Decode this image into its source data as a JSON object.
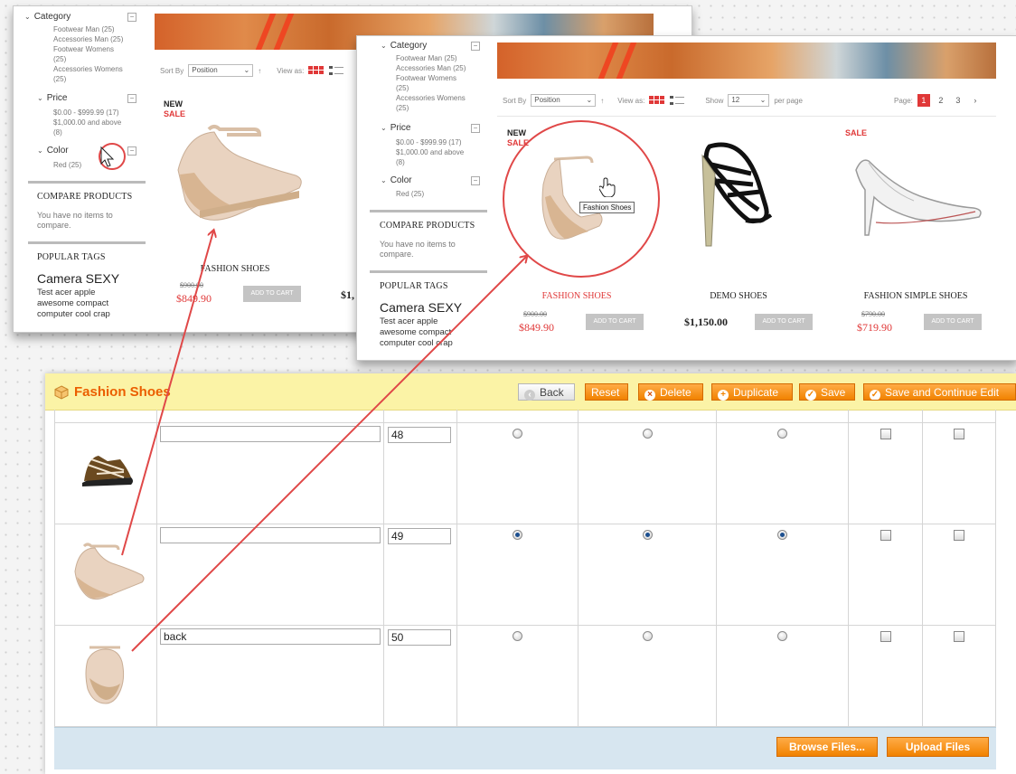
{
  "store": {
    "filters": {
      "category": {
        "title": "Category",
        "items": [
          "Footwear Man (25)",
          "Accessories Man (25)",
          "Footwear Womens",
          "(25)",
          "Accessories Womens",
          "(25)"
        ]
      },
      "price": {
        "title": "Price",
        "items": [
          "$0.00 - $999.99 (17)",
          "$1,000.00 and above",
          "(8)"
        ]
      },
      "color": {
        "title": "Color",
        "items": [
          "Red (25)"
        ]
      }
    },
    "compare": {
      "title": "COMPARE PRODUCTS",
      "text_1": "You have no items to",
      "text_2": "compare."
    },
    "tags": {
      "title": "POPULAR TAGS",
      "big": "Camera SEXY",
      "line1": "Test  acer  apple",
      "line2": "awesome  compact",
      "line3": "computer  cool  crap"
    },
    "toolbar": {
      "sort_label": "Sort By",
      "sort_value": "Position",
      "sort_arrow": "↑",
      "view_label": "View as:",
      "show_label": "Show",
      "show_value": "12",
      "per_page": "per page",
      "page_label": "Page:",
      "pages": [
        "1",
        "2",
        "3"
      ],
      "next": "›"
    },
    "products": [
      {
        "new": "NEW",
        "sale": "SALE",
        "name": "FASHION SHOES",
        "old_price": "$900.00",
        "price": "$849.90",
        "button": "ADD TO CART",
        "tooltip": "Fashion Shoes"
      },
      {
        "name": "DEMO SHOES",
        "price": "$1,150.00",
        "button": "ADD TO CART"
      },
      {
        "sale": "SALE",
        "name": "FASHION SIMPLE SHOES",
        "old_price": "$790.00",
        "price": "$719.90",
        "button": "ADD TO CART"
      }
    ],
    "back_shot": {
      "new": "NEW",
      "sale": "SALE",
      "name": "FASHION SHOES",
      "old_price": "$900.00",
      "price": "$849.90",
      "button": "ADD TO CART",
      "partial_price": "$1,"
    }
  },
  "admin": {
    "title": "Fashion Shoes",
    "buttons": {
      "back": "Back",
      "reset": "Reset",
      "delete": "Delete",
      "duplicate": "Duplicate",
      "save": "Save",
      "save_continue": "Save and Continue Edit"
    },
    "rows": [
      {
        "label": "",
        "position": "48",
        "base": false,
        "small": false,
        "thumb": false
      },
      {
        "label": "",
        "position": "49",
        "base": true,
        "small": true,
        "thumb": true
      },
      {
        "label": "back",
        "position": "50",
        "base": false,
        "small": false,
        "thumb": false
      }
    ],
    "browse_button": "Browse Files...",
    "upload_button": "Upload Files"
  },
  "colors": {
    "accent_orange": "#f18200",
    "title_orange": "#eb5e00",
    "sale_red": "#e03838",
    "annotation_red": "#e04848",
    "admin_bar": "#fbf3a6",
    "footer_blue": "#d7e6f0"
  }
}
